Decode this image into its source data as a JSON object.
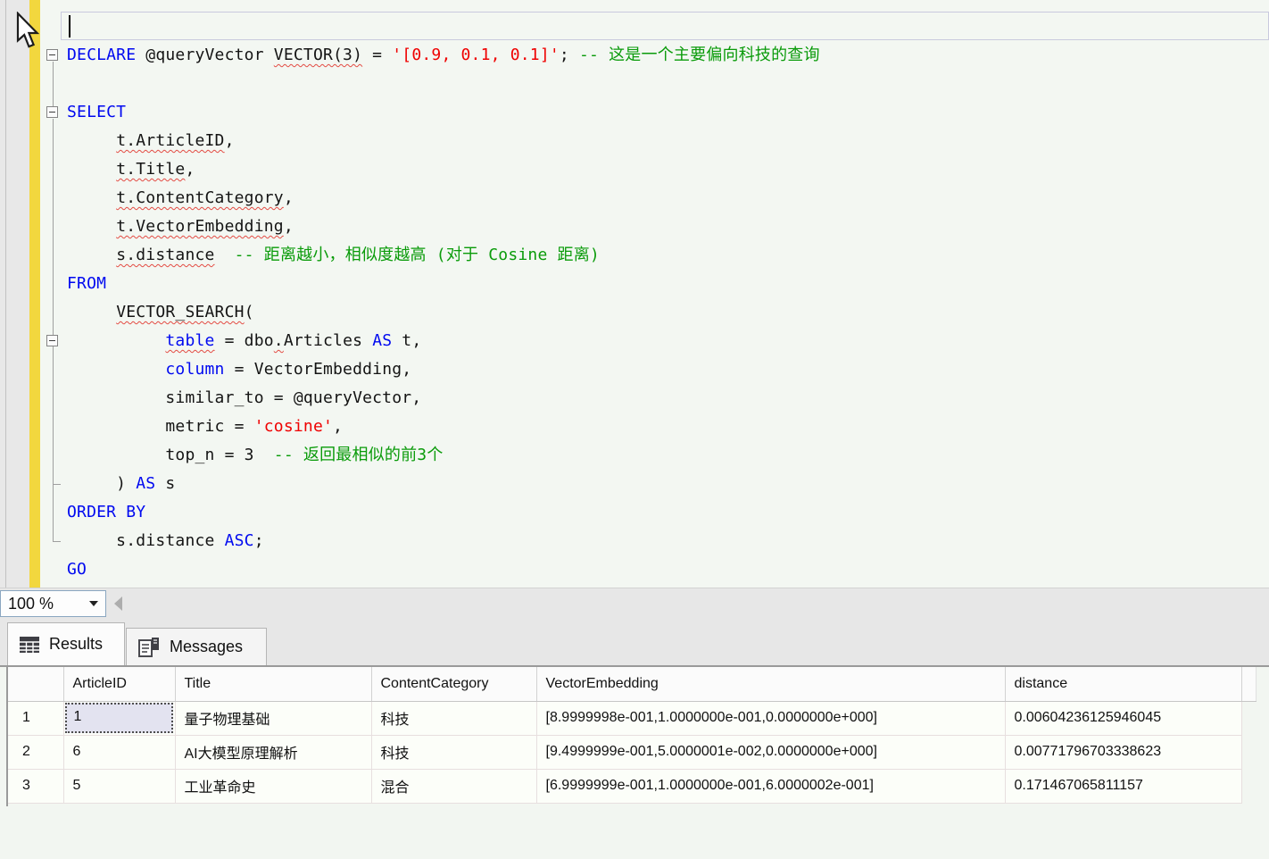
{
  "editor": {
    "zoom_value": "100 %",
    "lines": [
      {
        "current": true,
        "segments": []
      },
      {
        "outline": "box",
        "segments": [
          {
            "t": "DECLARE",
            "c": "k"
          },
          {
            "t": " @queryVector ",
            "c": "i"
          },
          {
            "t": "VECTOR(3)",
            "c": "i",
            "sq": true
          },
          {
            "t": " = ",
            "c": "i"
          },
          {
            "t": "'[0.9, 0.1, 0.1]'",
            "c": "s"
          },
          {
            "t": "; ",
            "c": "i"
          },
          {
            "t": "-- 这是一个主要偏向科技的查询",
            "c": "c"
          }
        ]
      },
      {
        "segments": []
      },
      {
        "outline": "box",
        "segments": [
          {
            "t": "SELECT",
            "c": "k"
          }
        ]
      },
      {
        "segments": [
          {
            "t": "     ",
            "c": "i"
          },
          {
            "t": "t.ArticleID",
            "c": "i",
            "sq": true
          },
          {
            "t": ",",
            "c": "i"
          }
        ]
      },
      {
        "segments": [
          {
            "t": "     ",
            "c": "i"
          },
          {
            "t": "t.Title",
            "c": "i",
            "sq": true
          },
          {
            "t": ",",
            "c": "i"
          }
        ]
      },
      {
        "segments": [
          {
            "t": "     ",
            "c": "i"
          },
          {
            "t": "t.ContentCategory",
            "c": "i",
            "sq": true
          },
          {
            "t": ",",
            "c": "i"
          }
        ]
      },
      {
        "segments": [
          {
            "t": "     ",
            "c": "i"
          },
          {
            "t": "t.VectorEmbedding",
            "c": "i",
            "sq": true
          },
          {
            "t": ",",
            "c": "i"
          }
        ]
      },
      {
        "segments": [
          {
            "t": "     ",
            "c": "i"
          },
          {
            "t": "s.distance",
            "c": "i",
            "sq": true
          },
          {
            "t": "  ",
            "c": "i"
          },
          {
            "t": "-- 距离越小，相似度越高 (对于 Cosine 距离)",
            "c": "c"
          }
        ]
      },
      {
        "segments": [
          {
            "t": "FROM",
            "c": "k"
          }
        ]
      },
      {
        "segments": [
          {
            "t": "     ",
            "c": "i"
          },
          {
            "t": "VECTOR_SEARCH",
            "c": "i",
            "sq": true
          },
          {
            "t": "(",
            "c": "i"
          }
        ]
      },
      {
        "outline": "box",
        "segments": [
          {
            "t": "          ",
            "c": "i"
          },
          {
            "t": "table",
            "c": "k",
            "sq": true
          },
          {
            "t": " = dbo",
            "c": "i"
          },
          {
            "t": ".",
            "c": "i",
            "sq": true
          },
          {
            "t": "Articles ",
            "c": "i"
          },
          {
            "t": "AS",
            "c": "k"
          },
          {
            "t": " t,",
            "c": "i"
          }
        ]
      },
      {
        "segments": [
          {
            "t": "          ",
            "c": "i"
          },
          {
            "t": "column",
            "c": "k"
          },
          {
            "t": " = VectorEmbedding,",
            "c": "i"
          }
        ]
      },
      {
        "segments": [
          {
            "t": "          ",
            "c": "i"
          },
          {
            "t": "similar_to = @queryVector,",
            "c": "i"
          }
        ]
      },
      {
        "segments": [
          {
            "t": "          ",
            "c": "i"
          },
          {
            "t": "metric = ",
            "c": "i"
          },
          {
            "t": "'cosine'",
            "c": "s"
          },
          {
            "t": ",",
            "c": "i"
          }
        ]
      },
      {
        "segments": [
          {
            "t": "          ",
            "c": "i"
          },
          {
            "t": "top_n = 3  ",
            "c": "i"
          },
          {
            "t": "-- 返回最相似的前3个",
            "c": "c"
          }
        ]
      },
      {
        "outline": "end",
        "segments": [
          {
            "t": "     ) ",
            "c": "i"
          },
          {
            "t": "AS",
            "c": "k"
          },
          {
            "t": " s",
            "c": "i"
          }
        ]
      },
      {
        "segments": [
          {
            "t": "ORDER BY",
            "c": "k"
          }
        ]
      },
      {
        "outline": "end",
        "segments": [
          {
            "t": "     s.distance ",
            "c": "i"
          },
          {
            "t": "ASC",
            "c": "k"
          },
          {
            "t": ";",
            "c": "i"
          }
        ]
      },
      {
        "segments": [
          {
            "t": "GO",
            "c": "k"
          }
        ]
      }
    ]
  },
  "results_pane": {
    "tabs": [
      {
        "label": "Results",
        "icon": "results-grid-icon",
        "active": true
      },
      {
        "label": "Messages",
        "icon": "messages-icon",
        "active": false
      }
    ],
    "columns": [
      "ArticleID",
      "Title",
      "ContentCategory",
      "VectorEmbedding",
      "distance"
    ],
    "rows": [
      {
        "num": "1",
        "cells": [
          "1",
          "量子物理基础",
          "科技",
          "[8.9999998e-001,1.0000000e-001,0.0000000e+000]",
          "0.00604236125946045"
        ],
        "selected_cell": 0
      },
      {
        "num": "2",
        "cells": [
          "6",
          "AI大模型原理解析",
          "科技",
          "[9.4999999e-001,5.0000001e-002,0.0000000e+000]",
          "0.00771796703338623"
        ]
      },
      {
        "num": "3",
        "cells": [
          "5",
          "工业革命史",
          "混合",
          "[6.9999999e-001,1.0000000e-001,6.0000002e-001]",
          "0.171467065811157"
        ]
      }
    ]
  },
  "colors": {
    "keyword_blue": "#0009f0",
    "comment_green": "#0a9b0a",
    "string_red": "#ef0000",
    "squiggle_red": "#e34b43",
    "change_bar_yellow": "#f2d73e",
    "editor_background": "#f3f7f2",
    "selected_cell_fill": "#e3e3f0"
  }
}
